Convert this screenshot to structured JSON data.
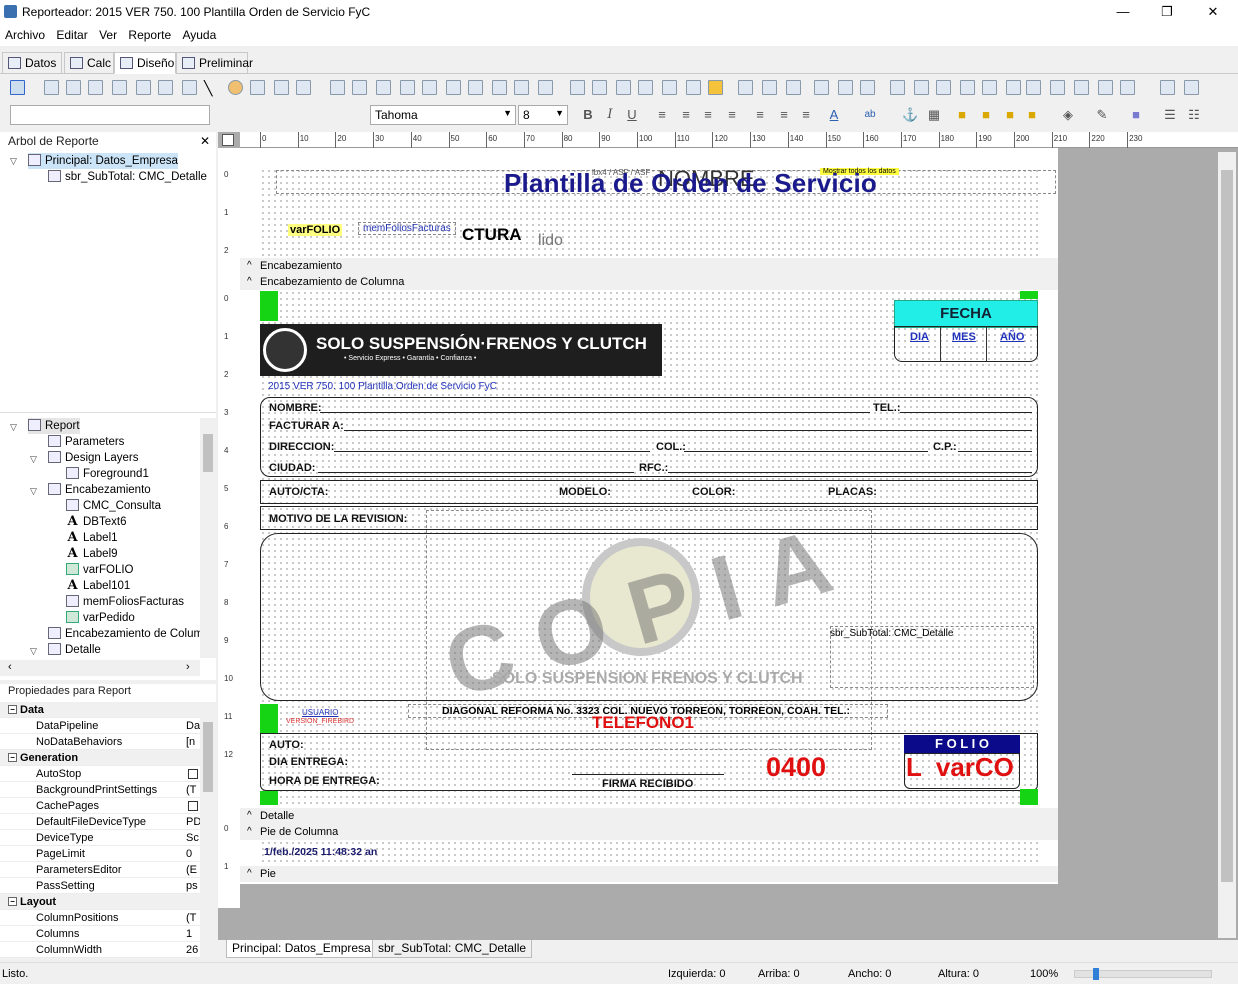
{
  "window": {
    "title": "Reporteador: 2015 VER 750. 100 Plantilla Orden de Servicio FyC",
    "min": "—",
    "max": "❐",
    "close": "✕"
  },
  "menu": [
    "Archivo",
    "Editar",
    "Ver",
    "Reporte",
    "Ayuda"
  ],
  "main_tabs": [
    "Datos",
    "Calc",
    "Diseño",
    "Preliminar"
  ],
  "font": {
    "name": "Tahoma",
    "size": "8"
  },
  "tree": {
    "header": "Arbol de Reporte",
    "close": "✕",
    "root": "Principal: Datos_Empresa",
    "child": "sbr_SubTotal: CMC_Detalle"
  },
  "tree2": [
    "Report",
    "Parameters",
    "Design Layers",
    "Foreground1",
    "Encabezamiento",
    "CMC_Consulta",
    "DBText6",
    "Label1",
    "Label9",
    "varFOLIO",
    "Label101",
    "memFoliosFacturas",
    "varPedido",
    "Encabezamiento de Columna",
    "Detalle"
  ],
  "props": {
    "header": "Propiedades para Report",
    "rows": [
      {
        "cat": true,
        "k": "Data"
      },
      {
        "k": "DataPipeline",
        "v": "Da"
      },
      {
        "k": "NoDataBehaviors",
        "v": "[n"
      },
      {
        "cat": true,
        "k": "Generation"
      },
      {
        "k": "AutoStop",
        "v": ""
      },
      {
        "k": "BackgroundPrintSettings",
        "v": "(T"
      },
      {
        "k": "CachePages",
        "v": ""
      },
      {
        "k": "DefaultFileDeviceType",
        "v": "PD"
      },
      {
        "k": "DeviceType",
        "v": "Sc"
      },
      {
        "k": "PageLimit",
        "v": "0"
      },
      {
        "k": "ParametersEditor",
        "v": "(E"
      },
      {
        "k": "PassSetting",
        "v": "ps"
      },
      {
        "cat": true,
        "k": "Layout"
      },
      {
        "k": "ColumnPositions",
        "v": "(T"
      },
      {
        "k": "Columns",
        "v": "1"
      },
      {
        "k": "ColumnWidth",
        "v": "26"
      }
    ]
  },
  "ruler": [
    "0",
    "10",
    "20",
    "30",
    "40",
    "50",
    "60",
    "70",
    "80",
    "90",
    "100",
    "110",
    "120",
    "130",
    "140",
    "150",
    "160",
    "170",
    "180",
    "190",
    "200",
    "210",
    "220",
    "230"
  ],
  "bands": {
    "enc": "Encabezamiento",
    "enc_col": "Encabezamiento de Columna",
    "detalle": "Detalle",
    "pie_col": "Pie de Columna",
    "pie": "Pie"
  },
  "report": {
    "title": "Plantilla de Orden de Servicio",
    "nombre_overlay": "NOMBRE",
    "small_top": "lbx4 / ASF / ASF",
    "mostrar": "Mostrar todos los datos",
    "varfolio": "varFOLIO",
    "memfolios": "memFoliosFacturas",
    "ctura": "CTURA",
    "lido": "lido",
    "brand": "SOLO SUSPENSIÓN·FRENOS Y CLUTCH",
    "brand_sub": "• Servicio Express • Garantía • Confianza •",
    "fecha": "FECHA",
    "dia": "DIA",
    "mes": "MES",
    "anio": "AÑO",
    "filename": "2015 VER 750. 100 Plantilla Orden de Servicio FyC",
    "nombre": "NOMBRE:",
    "tel": "TEL.:",
    "facturar": "FACTURAR A:",
    "direccion": "DIRECCION:",
    "col": "COL.:",
    "cp": "C.P.:",
    "ciudad": "CIUDAD:",
    "rfc": "RFC.:",
    "auto_cta": "AUTO/CTA:",
    "modelo": "MODELO:",
    "color": "COLOR:",
    "placas": "PLACAS:",
    "motivo": "MOTIVO DE LA REVISION:",
    "copia": "COPIA",
    "watermark_brand": "SOLO SUSPENSION FRENOS Y CLUTCH",
    "subreport": "sbr_SubTotal: CMC_Detalle",
    "usuario": "USUARIO",
    "version": "VERSION_FIREBIRD",
    "direccion_taller": "DIAGONAL REFORMA No. 3323 COL. NUEVO TORREON, TORREON, COAH. TEL.:",
    "telefono": "TELEFONO1",
    "auto": "AUTO:",
    "dia_entrega": "DIA ENTREGA:",
    "hora_entrega": "HORA DE ENTREGA:",
    "firma": "FIRMA RECIBIDO",
    "num": "0400",
    "folio": "F O L I O",
    "varco": "L  varCO",
    "fecha_impresion": "1/feb./2025 11:48:32 an"
  },
  "bottom_tabs": [
    "Principal: Datos_Empresa",
    "sbr_SubTotal: CMC_Detalle"
  ],
  "status": {
    "left": "Listo.",
    "izq": "Izquierda: 0",
    "arriba": "Arriba: 0",
    "ancho": "Ancho: 0",
    "altura": "Altura: 0",
    "zoom": "100%",
    "zoom_level": 0.04
  }
}
